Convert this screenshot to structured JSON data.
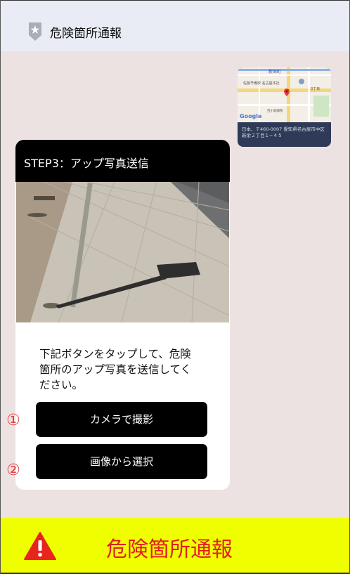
{
  "header": {
    "title": "危険箇所通報",
    "icon": "shield-star-icon"
  },
  "map": {
    "labels": [
      "新栄町",
      "佐藤予備校 名古屋本社",
      "3丁目",
      "Google",
      "百小堀病院"
    ],
    "caption": "日本、〒460-0007 愛知県名古屋市中区新栄２丁目１−４５"
  },
  "card": {
    "step_title": "STEP3：アップ写真送信",
    "description": "下記ボタンをタップして、危険箇所のアップ写真を送信してください。",
    "camera_button": "カメラで撮影",
    "gallery_button": "画像から選択"
  },
  "markers": {
    "one": "①",
    "two": "②"
  },
  "footer": {
    "label": "危険箇所通報",
    "icon": "warning-icon"
  },
  "colors": {
    "footer_bg": "#f0ff00",
    "accent_red": "#e21f1f",
    "header_bg": "#e9ecf4"
  }
}
